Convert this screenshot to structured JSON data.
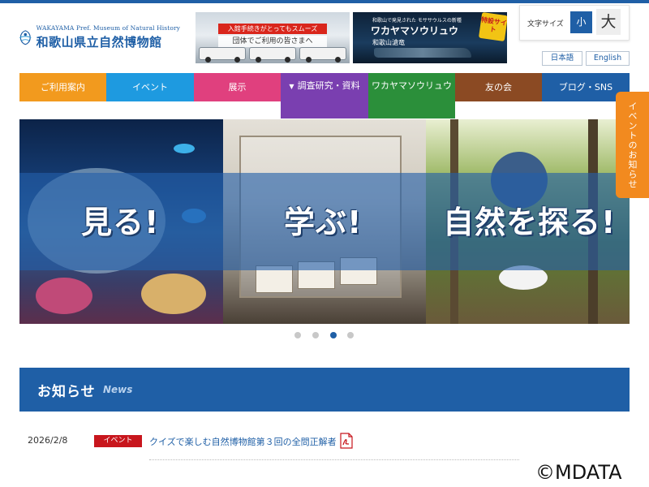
{
  "header": {
    "logo_en": "WAKAYAMA Pref. Museum of Natural History",
    "logo_jp": "和歌山県立自然博物館",
    "banner1": {
      "line1": "入館手続きがとってもスムーズ",
      "line2": "団体でご利用の皆さまへ"
    },
    "banner2": {
      "small": "和歌山で発見された モササウルスの新種",
      "title": "ワカヤマソウリュウ",
      "sub": "和歌山滄竜",
      "badge": "特設サイト"
    },
    "fontsize": {
      "label": "文字サイズ",
      "small": "小",
      "large": "大"
    },
    "lang": {
      "ja": "日本語",
      "en": "English"
    }
  },
  "nav": {
    "items": [
      {
        "label": "ご利用案内",
        "color": "#f29a1e"
      },
      {
        "label": "イベント",
        "color": "#1e9ae0"
      },
      {
        "label": "展示",
        "color": "#e0407e"
      },
      {
        "label": "調査研究・資料",
        "color": "#7a3fb0"
      },
      {
        "label": "ワカヤマソウリュウ",
        "color": "#2b8f3a"
      },
      {
        "label": "友の会",
        "color": "#8b4a23"
      },
      {
        "label": "ブログ・SNS",
        "color": "#1f5fa6"
      }
    ]
  },
  "side_tab": {
    "label": "イベントのお知らせ",
    "color": "#f28a1f"
  },
  "hero": {
    "panels": [
      {
        "text": "見る!"
      },
      {
        "text": "学ぶ!"
      },
      {
        "text": "自然を探る!"
      }
    ],
    "slider_dots": 4,
    "active_dot": 3
  },
  "news": {
    "title": "お知らせ",
    "subtitle": "News",
    "items": [
      {
        "date": "2026/2/8",
        "category": "イベント",
        "text": "クイズで楽しむ自然博物館第３回の全問正解者"
      }
    ]
  },
  "watermark": "©MDATA",
  "colors": {
    "brand": "#1f5fa6",
    "badge_red": "#c8161d"
  }
}
